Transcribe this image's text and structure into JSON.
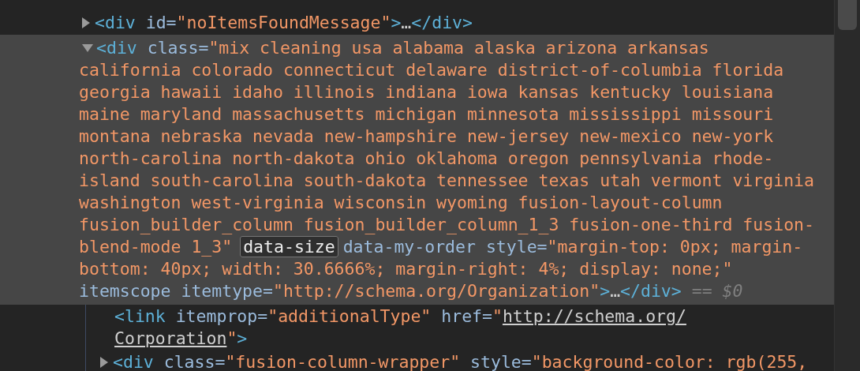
{
  "rows": [
    {
      "selected": false,
      "kind": "parent",
      "expanded": false,
      "lines": [
        [
          {
            "kind": "tag",
            "text": "<div"
          },
          {
            "kind": "attr",
            "text": " id="
          },
          {
            "kind": "value",
            "text": "\"noItemsFoundMessage\""
          },
          {
            "kind": "tag",
            "text": ">"
          },
          {
            "kind": "text",
            "text": "…"
          },
          {
            "kind": "tag",
            "text": "</div>"
          }
        ]
      ]
    },
    {
      "selected": true,
      "kind": "parent",
      "expanded": true,
      "lines": [
        [
          {
            "kind": "tag",
            "text": "<div"
          },
          {
            "kind": "attr",
            "text": " class="
          },
          {
            "kind": "value",
            "text": "\"mix cleaning usa alabama alaska arizona arkansas"
          }
        ],
        [
          {
            "kind": "value",
            "text": "california colorado connecticut delaware district-of-columbia florida"
          }
        ],
        [
          {
            "kind": "value",
            "text": "georgia hawaii idaho illinois indiana iowa kansas kentucky louisiana"
          }
        ],
        [
          {
            "kind": "value",
            "text": "maine maryland massachusetts michigan minnesota mississippi missouri"
          }
        ],
        [
          {
            "kind": "value",
            "text": "montana nebraska nevada new-hampshire new-jersey new-mexico new-york"
          }
        ],
        [
          {
            "kind": "value",
            "text": "north-carolina north-dakota ohio oklahoma oregon pennsylvania rhode-"
          }
        ],
        [
          {
            "kind": "value",
            "text": "island south-carolina south-dakota tennessee texas utah vermont virginia"
          }
        ],
        [
          {
            "kind": "value",
            "text": "washington west-virginia wisconsin wyoming fusion-layout-column"
          }
        ],
        [
          {
            "kind": "value",
            "text": "fusion_builder_column fusion_builder_column_1_3 fusion-one-third fusion-"
          }
        ],
        [
          {
            "kind": "value",
            "text": "blend-mode 1_3\""
          },
          {
            "kind": "badge",
            "text": "data-size"
          },
          {
            "kind": "attr",
            "text": "data-my-order style="
          },
          {
            "kind": "value",
            "text": "\"margin-top: 0px; margin-"
          }
        ],
        [
          {
            "kind": "value",
            "text": "bottom: 40px; width: 30.6666%; margin-right: 4%; display: none;\""
          }
        ],
        [
          {
            "kind": "attr",
            "text": "itemscope itemtype="
          },
          {
            "kind": "value",
            "text": "\"http://schema.org/Organization\""
          },
          {
            "kind": "tag",
            "text": ">"
          },
          {
            "kind": "text",
            "text": "…"
          },
          {
            "kind": "tag",
            "text": "</div>"
          },
          {
            "kind": "muted",
            "text": " == "
          },
          {
            "kind": "ref",
            "text": "$0"
          }
        ]
      ],
      "children": [
        {
          "selected": false,
          "kind": "leaf",
          "lines": [
            [
              {
                "kind": "tag",
                "text": "<link"
              },
              {
                "kind": "attr",
                "text": " itemprop="
              },
              {
                "kind": "value",
                "text": "\"additionalType\""
              },
              {
                "kind": "attr",
                "text": " href="
              },
              {
                "kind": "value",
                "text": "\""
              },
              {
                "kind": "link",
                "text": "http://schema.org/"
              }
            ],
            [
              {
                "kind": "link",
                "text": "Corporation"
              },
              {
                "kind": "value",
                "text": "\""
              },
              {
                "kind": "tag",
                "text": ">"
              }
            ]
          ]
        },
        {
          "selected": false,
          "kind": "parent",
          "expanded": false,
          "lines": [
            [
              {
                "kind": "tag",
                "text": "<div"
              },
              {
                "kind": "attr",
                "text": " class="
              },
              {
                "kind": "value",
                "text": "\"fusion-column-wrapper\""
              },
              {
                "kind": "attr",
                "text": " style="
              },
              {
                "kind": "value",
                "text": "\"background-color: rgb(255,"
              }
            ]
          ]
        }
      ]
    }
  ]
}
